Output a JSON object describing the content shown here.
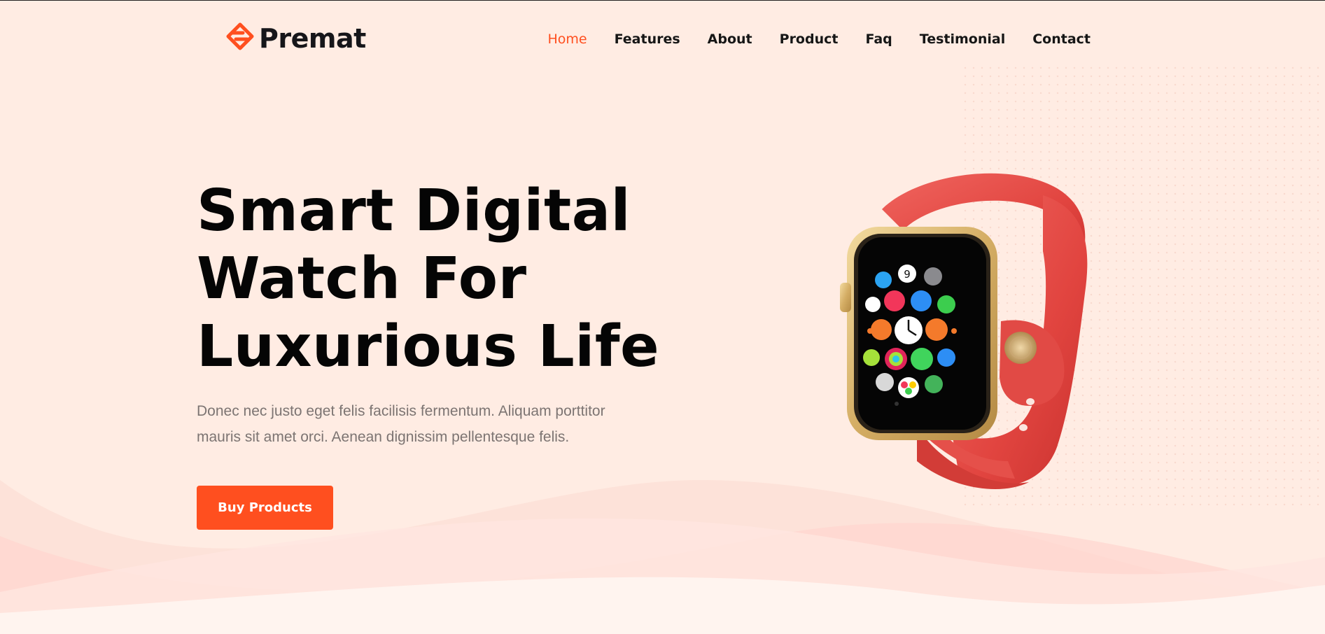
{
  "brand": {
    "name": "Premat",
    "logo_icon": "stacked-diamond-icon",
    "accent_color": "#ff4f1f"
  },
  "nav": {
    "items": [
      {
        "label": "Home",
        "active": true
      },
      {
        "label": "Features",
        "active": false
      },
      {
        "label": "About",
        "active": false
      },
      {
        "label": "Product",
        "active": false
      },
      {
        "label": "Faq",
        "active": false
      },
      {
        "label": "Testimonial",
        "active": false
      },
      {
        "label": "Contact",
        "active": false
      }
    ]
  },
  "hero": {
    "title_lines": [
      "Smart Digital",
      "Watch For",
      "Luxurious Life"
    ],
    "description": "Donec nec justo eget felis facilisis fermentum. Aliquam porttitor mauris sit amet orci. Aenean dignissim pellentesque felis.",
    "cta_label": "Buy Products"
  },
  "watch_face": {
    "date_day": "9"
  },
  "colors": {
    "background": "#ffece3",
    "title": "#050505",
    "description": "#7c7472",
    "strap": "#e64a45",
    "case": "#d9b56f"
  }
}
